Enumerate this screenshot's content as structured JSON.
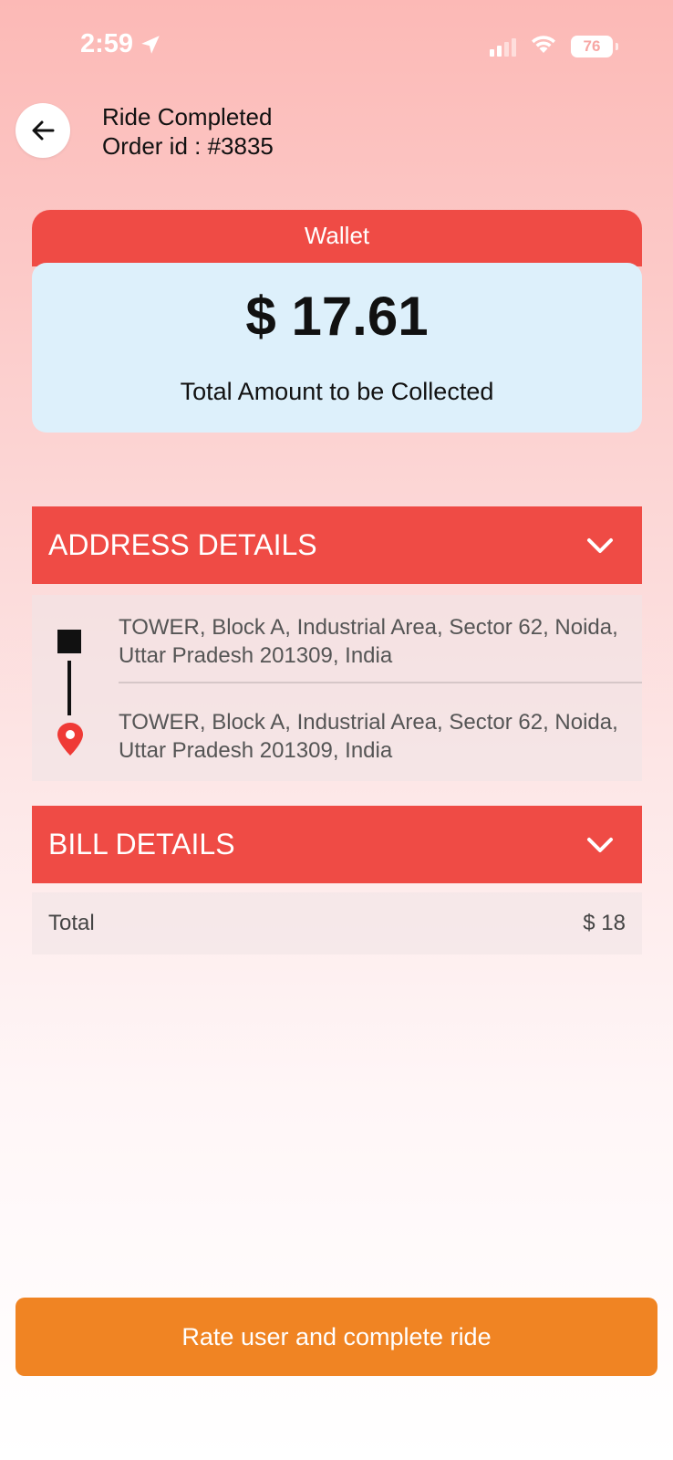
{
  "status_bar": {
    "time": "2:59",
    "battery": "76"
  },
  "header": {
    "title": "Ride Completed",
    "order_id": "Order id : #3835"
  },
  "wallet": {
    "label": "Wallet",
    "amount": "$ 17.61",
    "caption": "Total Amount to be Collected"
  },
  "address_section": {
    "title": "ADDRESS DETAILS",
    "pickup": "TOWER, Block A, Industrial Area, Sector 62, Noida, Uttar Pradesh 201309, India",
    "dropoff": "TOWER, Block A, Industrial Area, Sector 62, Noida, Uttar Pradesh 201309, India"
  },
  "bill_section": {
    "title": "BILL DETAILS",
    "total_label": "Total",
    "total_value": "$ 18"
  },
  "actions": {
    "complete_label": "Rate user and complete ride"
  },
  "colors": {
    "header_red": "#ef4b45",
    "wallet_bg": "#ddf0fb",
    "button_orange": "#f08423"
  }
}
